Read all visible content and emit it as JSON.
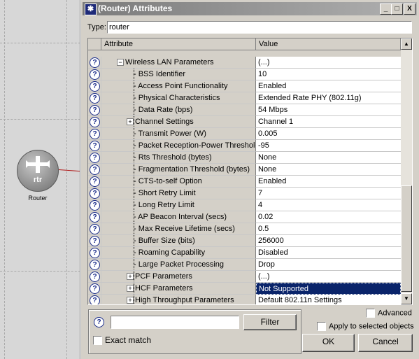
{
  "window": {
    "title": "(Router) Attributes",
    "controls": {
      "minimize": "_",
      "maximize": "□",
      "close": "X"
    }
  },
  "type_field": {
    "label": "Type:",
    "value": "router"
  },
  "grid": {
    "columns": [
      "Attribute",
      "Value"
    ],
    "rows": [
      {
        "attribute": "Wireless LAN Parameters",
        "value": "(...)",
        "level": 0,
        "expander": "minus"
      },
      {
        "attribute": "BSS Identifier",
        "value": "10",
        "level": 1,
        "expander": null
      },
      {
        "attribute": "Access Point Functionality",
        "value": "Enabled",
        "level": 1,
        "expander": null
      },
      {
        "attribute": "Physical Characteristics",
        "value": "Extended Rate PHY (802.11g)",
        "level": 1,
        "expander": null
      },
      {
        "attribute": "Data Rate (bps)",
        "value": "54 Mbps",
        "level": 1,
        "expander": null
      },
      {
        "attribute": "Channel Settings",
        "value": "Channel 1",
        "level": 1,
        "expander": "plus"
      },
      {
        "attribute": "Transmit Power (W)",
        "value": "0.005",
        "level": 1,
        "expander": null
      },
      {
        "attribute": "Packet Reception-Power Threshold...",
        "value": "-95",
        "level": 1,
        "expander": null
      },
      {
        "attribute": "Rts Threshold (bytes)",
        "value": "None",
        "level": 1,
        "expander": null
      },
      {
        "attribute": "Fragmentation Threshold (bytes)",
        "value": "None",
        "level": 1,
        "expander": null
      },
      {
        "attribute": "CTS-to-self Option",
        "value": "Enabled",
        "level": 1,
        "expander": null
      },
      {
        "attribute": "Short Retry Limit",
        "value": "7",
        "level": 1,
        "expander": null
      },
      {
        "attribute": "Long Retry Limit",
        "value": "4",
        "level": 1,
        "expander": null
      },
      {
        "attribute": "AP Beacon Interval (secs)",
        "value": "0.02",
        "level": 1,
        "expander": null
      },
      {
        "attribute": "Max Receive Lifetime (secs)",
        "value": "0.5",
        "level": 1,
        "expander": null
      },
      {
        "attribute": "Buffer Size (bits)",
        "value": "256000",
        "level": 1,
        "expander": null
      },
      {
        "attribute": "Roaming Capability",
        "value": "Disabled",
        "level": 1,
        "expander": null
      },
      {
        "attribute": "Large Packet Processing",
        "value": "Drop",
        "level": 1,
        "expander": null
      },
      {
        "attribute": "PCF Parameters",
        "value": "(...)",
        "level": 1,
        "expander": "plus"
      },
      {
        "attribute": "HCF Parameters",
        "value": "Not Supported",
        "level": 1,
        "expander": "plus",
        "selected": true
      },
      {
        "attribute": "High Throughput Parameters",
        "value": "Default 802.11n Settings",
        "level": 1,
        "expander": "plus"
      }
    ]
  },
  "options": {
    "advanced": "Advanced",
    "apply_selected": "Apply to selected objects"
  },
  "filter": {
    "button": "Filter",
    "exact_match": "Exact match"
  },
  "buttons": {
    "ok": "OK",
    "cancel": "Cancel"
  },
  "canvas": {
    "node_label": "Router",
    "node_code": "rtr"
  },
  "colors": {
    "selection": "#0a246a",
    "help_icon": "#1a2c8a",
    "dialog_bg": "#d4d0c8"
  }
}
